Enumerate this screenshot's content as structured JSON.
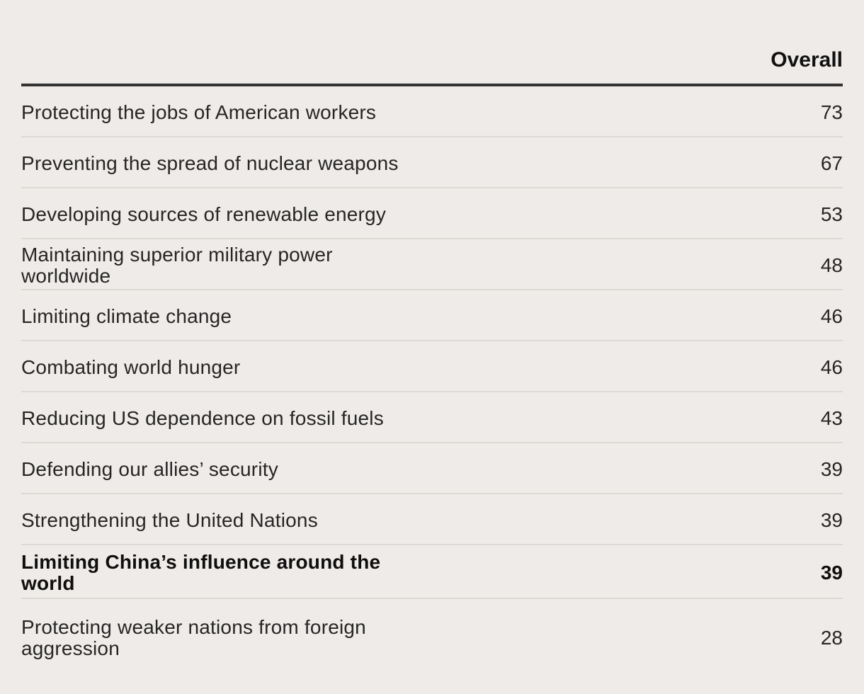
{
  "chart_data": {
    "type": "table",
    "column_header": "Overall",
    "rows": [
      {
        "label": "Protecting the jobs of American workers",
        "value": 73,
        "bold": false
      },
      {
        "label": "Preventing the spread of nuclear weapons",
        "value": 67,
        "bold": false
      },
      {
        "label": "Developing sources of renewable energy",
        "value": 53,
        "bold": false
      },
      {
        "label": "Maintaining superior military power worldwide",
        "value": 48,
        "bold": false
      },
      {
        "label": "Limiting climate change",
        "value": 46,
        "bold": false
      },
      {
        "label": "Combating world hunger",
        "value": 46,
        "bold": false
      },
      {
        "label": "Reducing US dependence on fossil fuels",
        "value": 43,
        "bold": false
      },
      {
        "label": "Defending our allies’ security",
        "value": 39,
        "bold": false
      },
      {
        "label": "Strengthening the United Nations",
        "value": 39,
        "bold": false
      },
      {
        "label": "Limiting China’s influence around the world",
        "value": 39,
        "bold": true
      },
      {
        "label": "Protecting weaker nations from foreign aggression",
        "value": 28,
        "bold": false
      }
    ]
  }
}
